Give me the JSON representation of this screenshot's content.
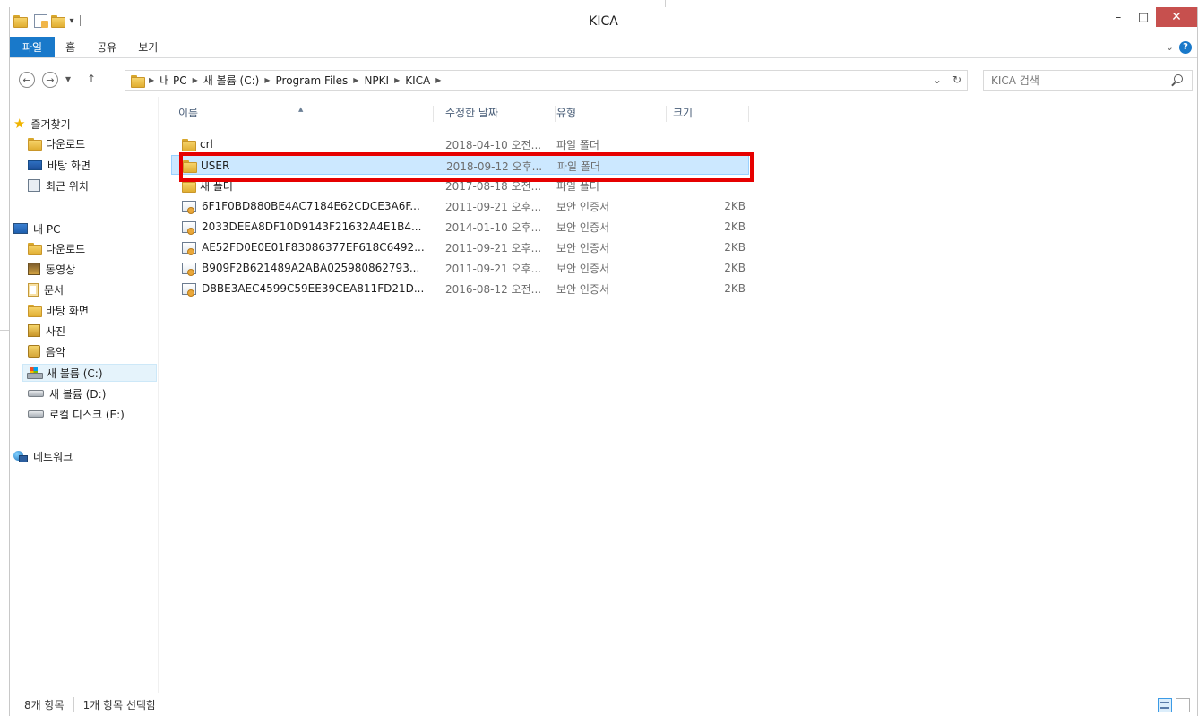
{
  "window": {
    "title": "KICA"
  },
  "window_controls": {
    "minimize": "–",
    "maximize": "□",
    "close": "✕"
  },
  "ribbon": {
    "tabs": [
      "파일",
      "홈",
      "공유",
      "보기"
    ],
    "expand_glyph": "⌄",
    "help_glyph": "?"
  },
  "nav": {
    "back": "←",
    "forward": "→",
    "recent": "▾",
    "up": "↑",
    "breadcrumb": [
      "내 PC",
      "새 볼륨 (C:)",
      "Program Files",
      "NPKI",
      "KICA"
    ],
    "dropdown": "⌄",
    "refresh": "↻"
  },
  "search": {
    "placeholder": "KICA 검색"
  },
  "sidebar": {
    "favorites": {
      "label": "즐겨찾기",
      "items": [
        "다운로드",
        "바탕 화면",
        "최근 위치"
      ]
    },
    "this_pc": {
      "label": "내 PC",
      "items": [
        "다운로드",
        "동영상",
        "문서",
        "바탕 화면",
        "사진",
        "음악",
        "새 볼륨 (C:)",
        "새 볼륨 (D:)",
        "로컬 디스크 (E:)"
      ],
      "selected": "새 볼륨 (C:)"
    },
    "network": {
      "label": "네트워크"
    }
  },
  "columns": {
    "name": "이름",
    "date": "수정한 날짜",
    "type": "유형",
    "size": "크기"
  },
  "files": [
    {
      "name": "crl",
      "date": "2018-04-10 오전...",
      "type": "파일 폴더",
      "size": "",
      "kind": "folder"
    },
    {
      "name": "USER",
      "date": "2018-09-12 오후...",
      "type": "파일 폴더",
      "size": "",
      "kind": "folder",
      "selected": true
    },
    {
      "name": "새 폴더",
      "date": "2017-08-18 오전...",
      "type": "파일 폴더",
      "size": "",
      "kind": "folder"
    },
    {
      "name": "6F1F0BD880BE4AC7184E62CDCE3A6F...",
      "date": "2011-09-21 오후...",
      "type": "보안 인증서",
      "size": "2KB",
      "kind": "cert"
    },
    {
      "name": "2033DEEA8DF10D9143F21632A4E1B4...",
      "date": "2014-01-10 오후...",
      "type": "보안 인증서",
      "size": "2KB",
      "kind": "cert"
    },
    {
      "name": "AE52FD0E0E01F83086377EF618C6492...",
      "date": "2011-09-21 오후...",
      "type": "보안 인증서",
      "size": "2KB",
      "kind": "cert"
    },
    {
      "name": "B909F2B621489A2ABA025980862793...",
      "date": "2011-09-21 오후...",
      "type": "보안 인증서",
      "size": "2KB",
      "kind": "cert"
    },
    {
      "name": "D8BE3AEC4599C59EE39CEA811FD21D...",
      "date": "2016-08-12 오전...",
      "type": "보안 인증서",
      "size": "2KB",
      "kind": "cert"
    }
  ],
  "status": {
    "count": "8개 항목",
    "selection": "1개 항목 선택함"
  },
  "colors": {
    "accent": "#1979ca",
    "selection": "#cce8ff",
    "highlight": "#e60000",
    "close": "#c7504e"
  }
}
